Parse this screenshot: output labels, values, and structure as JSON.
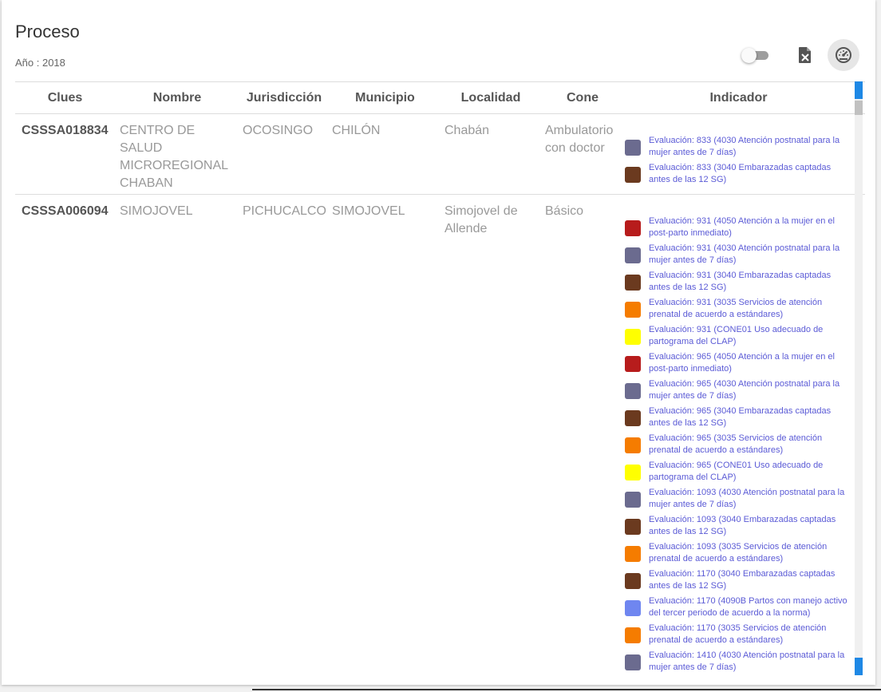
{
  "header": {
    "title": "Proceso",
    "year_label": "Año : 2018"
  },
  "toolbar": {
    "toggle_icon": "toggle-switch-icon",
    "export_icon": "excel-file-icon",
    "dashboard_icon": "speedometer-icon"
  },
  "table": {
    "columns": [
      "Clues",
      "Nombre",
      "Jurisdicción",
      "Municipio",
      "Localidad",
      "Cone",
      "Indicador"
    ],
    "rows": [
      {
        "clues": "CSSSA018834",
        "nombre": "CENTRO DE SALUD MICROREGIONAL CHABAN",
        "jurisdiccion": "OCOSINGO",
        "municipio": "CHILÓN",
        "localidad": "Chabán",
        "cone": "Ambulatorio con doctor",
        "indicadores": [
          {
            "color": "#6b6b8f",
            "text": "Evaluación: 833 (4030 Atención postnatal para la mujer antes de 7 días)"
          },
          {
            "color": "#6b3a1f",
            "text": "Evaluación: 833 (3040 Embarazadas captadas antes de las 12 SG)"
          }
        ]
      },
      {
        "clues": "CSSSA006094",
        "nombre": "SIMOJOVEL",
        "jurisdiccion": "PICHUCALCO",
        "municipio": "SIMOJOVEL",
        "localidad": "Simojovel de Allende",
        "cone": "Básico",
        "indicadores": [
          {
            "color": "#b71c1c",
            "text": "Evaluación: 931 (4050 Atención a la mujer en el post-parto inmediato)"
          },
          {
            "color": "#6b6b8f",
            "text": "Evaluación: 931 (4030 Atención postnatal para la mujer antes de 7 días)"
          },
          {
            "color": "#6b3a1f",
            "text": "Evaluación: 931 (3040 Embarazadas captadas antes de las 12 SG)"
          },
          {
            "color": "#f57c00",
            "text": "Evaluación: 931 (3035 Servicios de atención prenatal de acuerdo a estándares)"
          },
          {
            "color": "#ffff00",
            "text": "Evaluación: 931 (CONE01 Uso adecuado de partograma del CLAP)"
          },
          {
            "color": "#b71c1c",
            "text": "Evaluación: 965 (4050 Atención a la mujer en el post-parto inmediato)"
          },
          {
            "color": "#6b6b8f",
            "text": "Evaluación: 965 (4030 Atención postnatal para la mujer antes de 7 días)"
          },
          {
            "color": "#6b3a1f",
            "text": "Evaluación: 965 (3040 Embarazadas captadas antes de las 12 SG)"
          },
          {
            "color": "#f57c00",
            "text": "Evaluación: 965 (3035 Servicios de atención prenatal de acuerdo a estándares)"
          },
          {
            "color": "#ffff00",
            "text": "Evaluación: 965 (CONE01 Uso adecuado de partograma del CLAP)"
          },
          {
            "color": "#6b6b8f",
            "text": "Evaluación: 1093 (4030 Atención postnatal para la mujer antes de 7 días)"
          },
          {
            "color": "#6b3a1f",
            "text": "Evaluación: 1093 (3040 Embarazadas captadas antes de las 12 SG)"
          },
          {
            "color": "#f57c00",
            "text": "Evaluación: 1093 (3035 Servicios de atención prenatal de acuerdo a estándares)"
          },
          {
            "color": "#6b3a1f",
            "text": "Evaluación: 1170 (3040 Embarazadas captadas antes de las 12 SG)"
          },
          {
            "color": "#6f86f0",
            "text": "Evaluación: 1170 (4090B Partos con manejo activo del tercer periodo de acuerdo a la norma)"
          },
          {
            "color": "#f57c00",
            "text": "Evaluación: 1170 (3035 Servicios de atención prenatal de acuerdo a estándares)"
          },
          {
            "color": "#6b6b8f",
            "text": "Evaluación: 1410 (4030 Atención postnatal para la mujer antes de 7 días)"
          }
        ]
      }
    ]
  }
}
